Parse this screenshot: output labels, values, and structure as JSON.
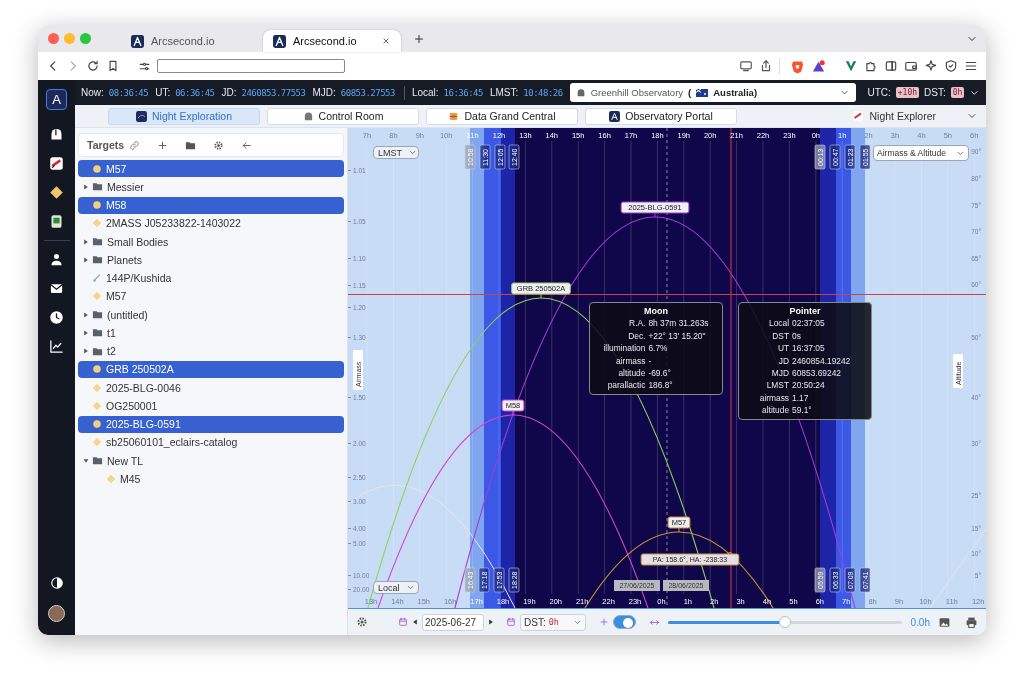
{
  "browser": {
    "tabs": [
      {
        "title": "Arcsecond.io",
        "selected": false
      },
      {
        "title": "Arcsecond.io",
        "selected": true
      }
    ]
  },
  "rail": {
    "logo": "A"
  },
  "status_bar": {
    "clock_groups": [
      [
        {
          "label": "Now:",
          "value": "08:36:45"
        },
        {
          "label": "UT:",
          "value": "06:36:45"
        },
        {
          "label": "JD:",
          "value": "2460853.77553"
        },
        {
          "label": "MJD:",
          "value": "60853.27553"
        }
      ],
      [
        {
          "label": "Local:",
          "value": "16:36:45"
        },
        {
          "label": "LMST:",
          "value": "10:48:26"
        }
      ]
    ],
    "observatory": {
      "name": "Greenhill Observatory",
      "paren": "(",
      "country": "Australia)"
    },
    "utc": {
      "label": "UTC:",
      "value": "+10h"
    },
    "dst": {
      "label": "DST:",
      "value": "0h"
    }
  },
  "nav_tabs": [
    {
      "label": "Night Exploration",
      "selected": true
    },
    {
      "label": "Control Room",
      "selected": false
    },
    {
      "label": "Data Grand Central",
      "selected": false
    },
    {
      "label": "Observatory Portal",
      "selected": false
    }
  ],
  "workspace": {
    "label": "Night Explorer"
  },
  "sidebar": {
    "title": "Targets",
    "items": [
      {
        "kind": "target",
        "label": "M57",
        "selected": true
      },
      {
        "kind": "folder",
        "label": "Messier",
        "expanded": false,
        "selected": false
      },
      {
        "kind": "target",
        "label": "M58",
        "selected": true
      },
      {
        "kind": "target",
        "label": "2MASS J05233822-1403022",
        "selected": false
      },
      {
        "kind": "folder",
        "label": "Small Bodies",
        "expanded": false,
        "selected": false
      },
      {
        "kind": "folder",
        "label": "Planets",
        "expanded": false,
        "selected": false
      },
      {
        "kind": "comet",
        "label": "144P/Kushida",
        "selected": false
      },
      {
        "kind": "target",
        "label": "M57",
        "selected": false
      },
      {
        "kind": "folder",
        "label": "(untitled)",
        "expanded": false,
        "selected": false
      },
      {
        "kind": "folder",
        "label": "t1",
        "expanded": false,
        "selected": false
      },
      {
        "kind": "folder",
        "label": "t2",
        "expanded": false,
        "selected": false
      },
      {
        "kind": "target",
        "label": "GRB 250502A",
        "selected": true
      },
      {
        "kind": "target",
        "label": "2025-BLG-0046",
        "selected": false
      },
      {
        "kind": "target",
        "label": "OG250001",
        "selected": false
      },
      {
        "kind": "target",
        "label": "2025-BLG-0591",
        "selected": true
      },
      {
        "kind": "target",
        "label": "sb25060101_eclairs-catalog",
        "selected": false
      },
      {
        "kind": "folder",
        "label": "New TL",
        "expanded": true,
        "selected": false,
        "children": [
          {
            "kind": "target",
            "label": "M45",
            "selected": false
          }
        ]
      }
    ]
  },
  "chart": {
    "top_scale": "LMST",
    "bottom_scale": "Local",
    "mode": "Airmass & Altitude",
    "left_title": "Airmass",
    "right_title": "Altitude",
    "top_hours": [
      "7h",
      "8h",
      "9h",
      "10h",
      "11h",
      "12h",
      "13h",
      "14h",
      "15h",
      "16h",
      "17h",
      "18h",
      "19h",
      "20h",
      "21h",
      "22h",
      "23h",
      "0h",
      "1h",
      "2h",
      "3h",
      "4h",
      "5h",
      "6h"
    ],
    "bottom_hours": [
      "13h",
      "14h",
      "15h",
      "16h",
      "17h",
      "18h",
      "19h",
      "20h",
      "21h",
      "22h",
      "23h",
      "0h",
      "1h",
      "2h",
      "3h",
      "4h",
      "5h",
      "6h",
      "7h",
      "8h",
      "9h",
      "10h",
      "11h",
      "12h"
    ],
    "airmass_ticks": [
      "1.01",
      "1.05",
      "1.10",
      "1.15",
      "1.20",
      "1.30",
      "1.50",
      "2.00",
      "2.50",
      "3.00",
      "4.00",
      "5.00",
      "10.00",
      "20.00"
    ],
    "altitude_ticks": [
      "90°",
      "80°",
      "75°",
      "70°",
      "65°",
      "60°",
      "50°",
      "40°",
      "30°",
      "25°",
      "15°",
      "10°",
      "5°"
    ],
    "evening_marks": [
      "10:58",
      "11:30",
      "12:05",
      "12:40"
    ],
    "morning_marks": [
      "00:13",
      "00:47",
      "01:23",
      "01:55"
    ],
    "evening_local": [
      "16:43",
      "17:18",
      "17:53",
      "18:28"
    ],
    "morning_local": [
      "05:59",
      "06:33",
      "07:09",
      "07:41"
    ],
    "dates": [
      "27/06/2025",
      "28/06/2025"
    ],
    "targets": [
      {
        "label": "2025-BLG-0591",
        "color": "#a23bd6"
      },
      {
        "label": "GRB 250502A",
        "color": "#8fd35a"
      },
      {
        "label": "M58",
        "color": "#d045d6"
      },
      {
        "label": "M57",
        "color": "#c9923a"
      }
    ],
    "cursor_label": "PA: 158.6°, HA: -238:33",
    "tooltips": [
      {
        "title": "Moon",
        "rows": [
          {
            "key": "R.A.",
            "value": "8h 37m 31.263s"
          },
          {
            "key": "Dec.",
            "value": "+22° 13' 15.20\""
          },
          {
            "key": "illumination",
            "value": "6.7%"
          },
          {
            "key": "airmass",
            "value": "-"
          },
          {
            "key": "altitude",
            "value": "-69.6°"
          },
          {
            "key": "parallactic",
            "value": "186.8°"
          }
        ]
      },
      {
        "title": "Pointer",
        "rows": [
          {
            "key": "Local",
            "value": "02:37:05"
          },
          {
            "key": "DST",
            "value": "0s"
          },
          {
            "key": "UT",
            "value": "16:37:05"
          },
          {
            "key": "JD",
            "value": "2460854.19242"
          },
          {
            "key": "MJD",
            "value": "60853.69242"
          },
          {
            "key": "LMST",
            "value": "20:50:24"
          },
          {
            "key": "airmass",
            "value": "1.17"
          },
          {
            "key": "altitude",
            "value": "59.1°"
          }
        ]
      }
    ]
  },
  "toolbar": {
    "date": "2025-06-27",
    "dst_label": "DST:",
    "dst_value": "0h",
    "live": true,
    "slider": {
      "level": 0.5
    },
    "offset": "0.0h"
  }
}
